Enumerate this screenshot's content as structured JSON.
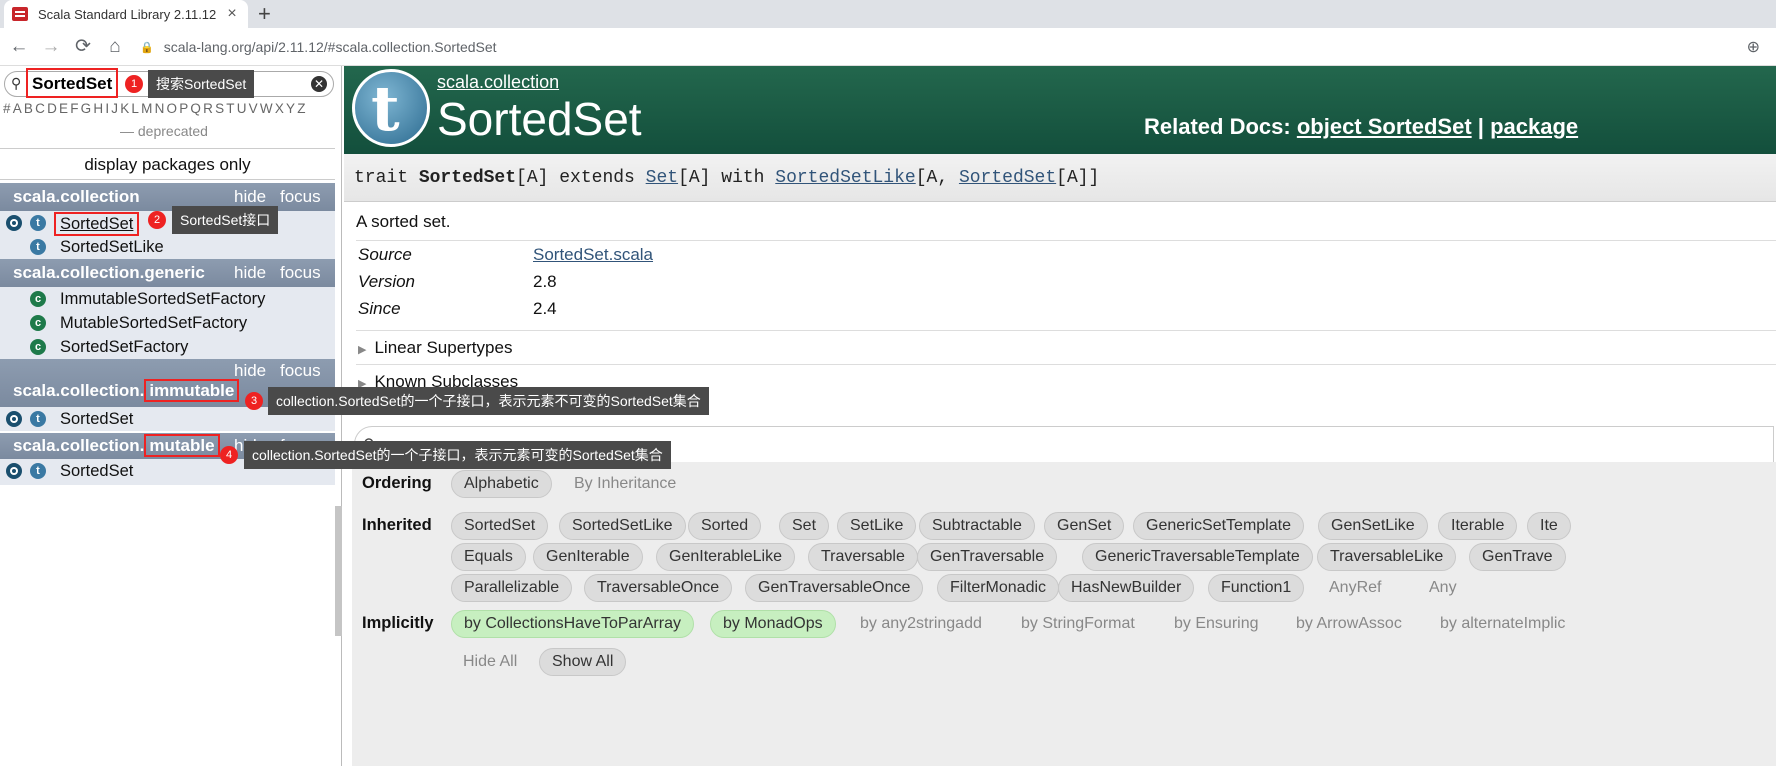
{
  "browser": {
    "tab_title": "Scala Standard Library 2.11.12",
    "tab_close": "×",
    "new_tab": "+",
    "back": "←",
    "forward": "→",
    "reload": "⟳",
    "home": "⌂",
    "url_host": "scala-lang.org",
    "url_path": "/api/2.11.12/#scala.collection.SortedSet",
    "zoom_icon": "⊕"
  },
  "left": {
    "search_value": "SortedSet",
    "letters": "#ABCDEFGHIJKLMNOPQRSTUVWXYZ",
    "deprecated": "— deprecated",
    "display_packages": "display packages only",
    "hide": "hide",
    "focus": "focus",
    "packages": [
      {
        "name": "scala.collection",
        "items": [
          {
            "label": "SortedSet"
          },
          {
            "label": "SortedSetLike"
          }
        ]
      },
      {
        "name": "scala.collection.generic",
        "items": [
          {
            "label": "ImmutableSortedSetFactory"
          },
          {
            "label": "MutableSortedSetFactory"
          },
          {
            "label": "SortedSetFactory"
          }
        ]
      },
      {
        "name_prefix": "scala.collection.",
        "name_hl": "immutable",
        "items": [
          {
            "label": "SortedSet"
          }
        ]
      },
      {
        "name_prefix": "scala.collection.",
        "name_hl": "mutable",
        "items": [
          {
            "label": "SortedSet"
          }
        ]
      }
    ]
  },
  "annotations": [
    {
      "num": "1",
      "text": "搜索SortedSet"
    },
    {
      "num": "2",
      "text": "SortedSet接口"
    },
    {
      "num": "3",
      "text": "collection.SortedSet的一个子接口，表示元素不可变的SortedSet集合"
    },
    {
      "num": "4",
      "text": "collection.SortedSet的一个子接口，表示元素可变的SortedSet集合"
    }
  ],
  "doc": {
    "package_prefix": "scala",
    "package_rest": "collection",
    "title": "SortedSet",
    "related_label": "Related Docs:",
    "related_object": "object SortedSet",
    "related_sep": "|",
    "related_package": "package",
    "sig": {
      "kw": "trait ",
      "name": "SortedSet",
      "tp": "[A] extends ",
      "set": "Set",
      "tp2": "[A] with ",
      "like": "SortedSetLike",
      "tp3": "[A, ",
      "sorted": "SortedSet",
      "tp4": "[A]]"
    },
    "comment": "A sorted set.",
    "attrs": [
      {
        "k": "Source",
        "v": "SortedSet.scala"
      },
      {
        "k": "Version",
        "v": "2.8"
      },
      {
        "k": "Since",
        "v": "2.4"
      }
    ],
    "linear_supertypes": "Linear Supertypes",
    "known_subclasses": "Known Subclasses",
    "tri": "▶"
  },
  "filter": {
    "ordering_label": "Ordering",
    "ordering": [
      "Alphabetic",
      "By Inheritance"
    ],
    "inherited_label": "Inherited",
    "inherited_row1": [
      "SortedSet",
      "SortedSetLike",
      "Sorted",
      "Set",
      "SetLike",
      "Subtractable",
      "GenSet",
      "GenericSetTemplate",
      "GenSetLike",
      "Iterable",
      "Ite"
    ],
    "inherited_row2": [
      "Equals",
      "GenIterable",
      "GenIterableLike",
      "Traversable",
      "GenTraversable",
      "GenericTraversableTemplate",
      "TraversableLike",
      "GenTrave"
    ],
    "inherited_row3": [
      "Parallelizable",
      "TraversableOnce",
      "GenTraversableOnce",
      "FilterMonadic",
      "HasNewBuilder",
      "Function1",
      "AnyRef",
      "Any"
    ],
    "implicitly_label": "Implicitly",
    "implicitly": [
      "by CollectionsHaveToParArray",
      "by MonadOps",
      "by any2stringadd",
      "by StringFormat",
      "by Ensuring",
      "by ArrowAssoc",
      "by alternateImplic"
    ],
    "hide_all": "Hide All",
    "show_all": "Show All"
  }
}
